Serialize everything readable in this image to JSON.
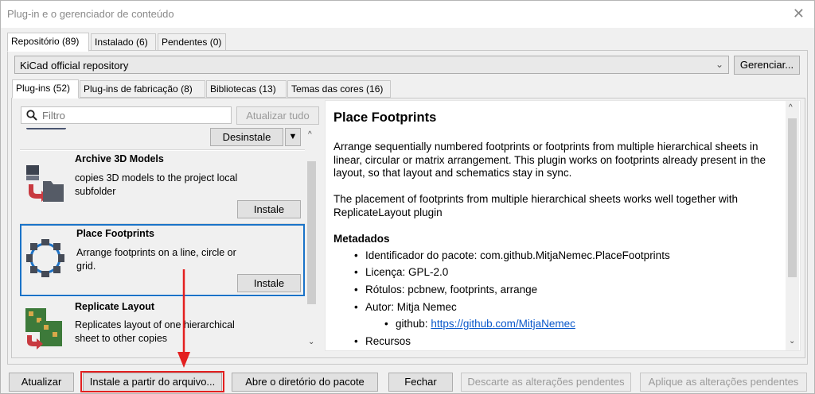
{
  "window": {
    "title": "Plug-in e o gerenciador de conteúdo",
    "close_glyph": "✕"
  },
  "top_tabs": [
    "Repositório (89)",
    "Instalado (6)",
    "Pendentes (0)"
  ],
  "repository": {
    "selected": "KiCad official repository",
    "manage_label": "Gerenciar..."
  },
  "sub_tabs": [
    "Plug-ins (52)",
    "Plug-ins de fabricação (8)",
    "Bibliotecas (13)",
    "Temas das cores (16)"
  ],
  "search": {
    "placeholder": "Filtro",
    "update_all_label": "Atualizar tudo"
  },
  "packages": [
    {
      "name": "",
      "description": "",
      "action": "Desinstale"
    },
    {
      "name": "Archive 3D Models",
      "description": "copies 3D models to the project local subfolder",
      "action": "Instale"
    },
    {
      "name": "Place Footprints",
      "description": "Arrange footprints on a line, circle or grid.",
      "action": "Instale"
    },
    {
      "name": "Replicate Layout",
      "description": "Replicates layout of one hierarchical sheet to other copies",
      "action": ""
    }
  ],
  "detail": {
    "title": "Place Footprints",
    "paragraph1": "Arrange sequentially numbered footprints or footprints from multiple hierarchical sheets in linear, circular or matrix arrangement. This plugin works on footprints already present in the layout, so that layout and schematics stay in sync.",
    "paragraph2": "The placement of footprints from multiple hierarchical sheets works well together with ReplicateLayout plugin",
    "metadata_heading": "Metadados",
    "meta": {
      "identifier": "Identificador do pacote: com.github.MitjaNemec.PlaceFootprints",
      "license": "Licença: GPL-2.0",
      "tags": "Rótulos: pcbnew, footprints, arrange",
      "author": "Autor: Mitja Nemec",
      "github_label": "github:",
      "github_url": "https://github.com/MitjaNemec",
      "resources": "Recursos"
    }
  },
  "footer": {
    "refresh": "Atualizar",
    "install_from_file": "Instale a partir do arquivo...",
    "open_dir": "Abre o diretório do pacote",
    "close": "Fechar",
    "discard": "Descarte as alterações pendentes",
    "apply": "Aplique as alterações pendentes"
  },
  "colors": {
    "selection_border": "#1a73c8",
    "annotation": "#e32020",
    "link": "#0a58ca"
  }
}
